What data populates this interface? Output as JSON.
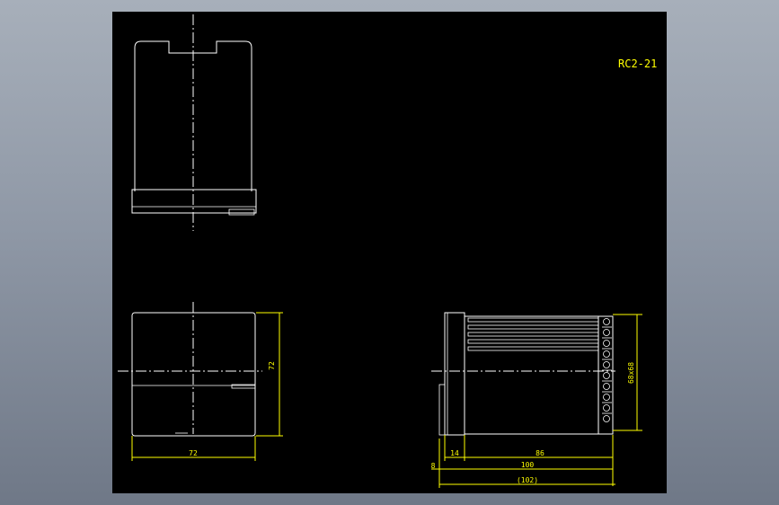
{
  "title_block": {
    "part_number": "RC2-21"
  },
  "dimensions": {
    "front_width": "72",
    "front_height": "72",
    "side_terminal_height": "68x68",
    "side_front_depth": "14",
    "side_body_depth": "86",
    "side_overall_small": "8",
    "side_overall": "100",
    "side_overall_paren": "(102)"
  },
  "colors": {
    "background": "#000000",
    "outline": "#ffffff",
    "dimension": "#ffff00",
    "window_frame": "#8f98a6"
  }
}
